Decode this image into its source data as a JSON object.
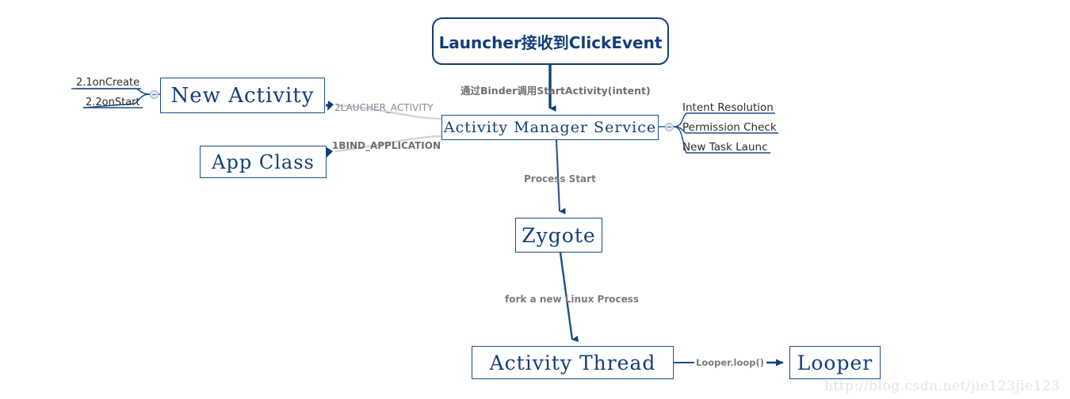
{
  "diagram": {
    "title_node": "Launcher接收到ClickEvent",
    "nodes": [
      {
        "id": "launcher",
        "label": "Launcher接收到ClickEvent"
      },
      {
        "id": "new-activity",
        "label": "New Activity"
      },
      {
        "id": "ams",
        "label": "Activity Manager Service"
      },
      {
        "id": "app-class",
        "label": "App Class"
      },
      {
        "id": "zygote",
        "label": "Zygote"
      },
      {
        "id": "activity-thread",
        "label": "Activity Thread"
      },
      {
        "id": "looper",
        "label": "Looper"
      }
    ],
    "edge_labels": {
      "binder_call": "通过Binder调用StartActivity(intent)",
      "laucher_activity": "2LAUCHER_ACTIVITY",
      "bind_application": "1BIND_APPLICATION",
      "process_start": "Process Start",
      "fork_process": "fork a new Linux Process",
      "looper_loop": "Looper.loop()"
    },
    "branches": {
      "left": [
        {
          "label": "2.1onCreate"
        },
        {
          "label": "2.2onStart"
        }
      ],
      "right": [
        {
          "label": "Intent Resolution"
        },
        {
          "label": "Permission Check"
        },
        {
          "label": "New Task Launc"
        }
      ]
    },
    "watermark": "http://blog.csdn.net/jie123jie123",
    "colors": {
      "node_border": "#1b4f8a",
      "node_text": "#123f79",
      "accent": "#123f79",
      "edge_label_text": "#7c7c7c",
      "branch_text": "#2b2b2b",
      "watermark_text": "#e4e4e4",
      "background": "#ffffff"
    }
  }
}
